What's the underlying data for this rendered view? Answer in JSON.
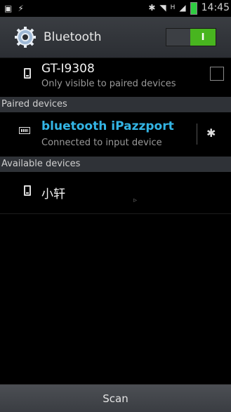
{
  "status_bar": {
    "time": "14:45",
    "network_label": "H"
  },
  "header": {
    "title": "Bluetooth",
    "toggle_label": "I"
  },
  "own_device": {
    "name": "GT-I9308",
    "subtitle": "Only visible to paired devices"
  },
  "sections": {
    "paired": "Paired devices",
    "available": "Available devices"
  },
  "paired_devices": [
    {
      "name": "bluetooth iPazzport",
      "status": "Connected to input device"
    }
  ],
  "available_devices": [
    {
      "name": "小轩"
    }
  ],
  "footer": {
    "scan_label": "Scan"
  },
  "colors": {
    "accent": "#33b5e5",
    "toggle_on": "#48b51f"
  }
}
